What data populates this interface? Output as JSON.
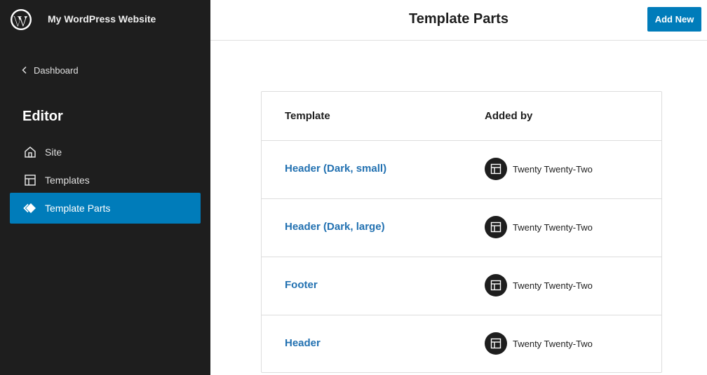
{
  "sidebar": {
    "site_title": "My WordPress Website",
    "back_label": "Dashboard",
    "section_title": "Editor",
    "items": [
      {
        "label": "Site",
        "icon": "home-icon",
        "active": false
      },
      {
        "label": "Templates",
        "icon": "layout-icon",
        "active": false
      },
      {
        "label": "Template Parts",
        "icon": "symbol-filled-icon",
        "active": true
      }
    ]
  },
  "header": {
    "title": "Template Parts",
    "add_new_label": "Add New"
  },
  "table": {
    "columns": [
      "Template",
      "Added by"
    ],
    "rows": [
      {
        "name": "Header (Dark, small)",
        "added_by": "Twenty Twenty-Two",
        "author_icon": "layout-icon"
      },
      {
        "name": "Header (Dark, large)",
        "added_by": "Twenty Twenty-Two",
        "author_icon": "layout-icon"
      },
      {
        "name": "Footer",
        "added_by": "Twenty Twenty-Two",
        "author_icon": "layout-icon"
      },
      {
        "name": "Header",
        "added_by": "Twenty Twenty-Two",
        "author_icon": "layout-icon"
      }
    ]
  },
  "colors": {
    "sidebar_bg": "#1e1e1e",
    "accent": "#007cba",
    "link": "#2271b1"
  }
}
